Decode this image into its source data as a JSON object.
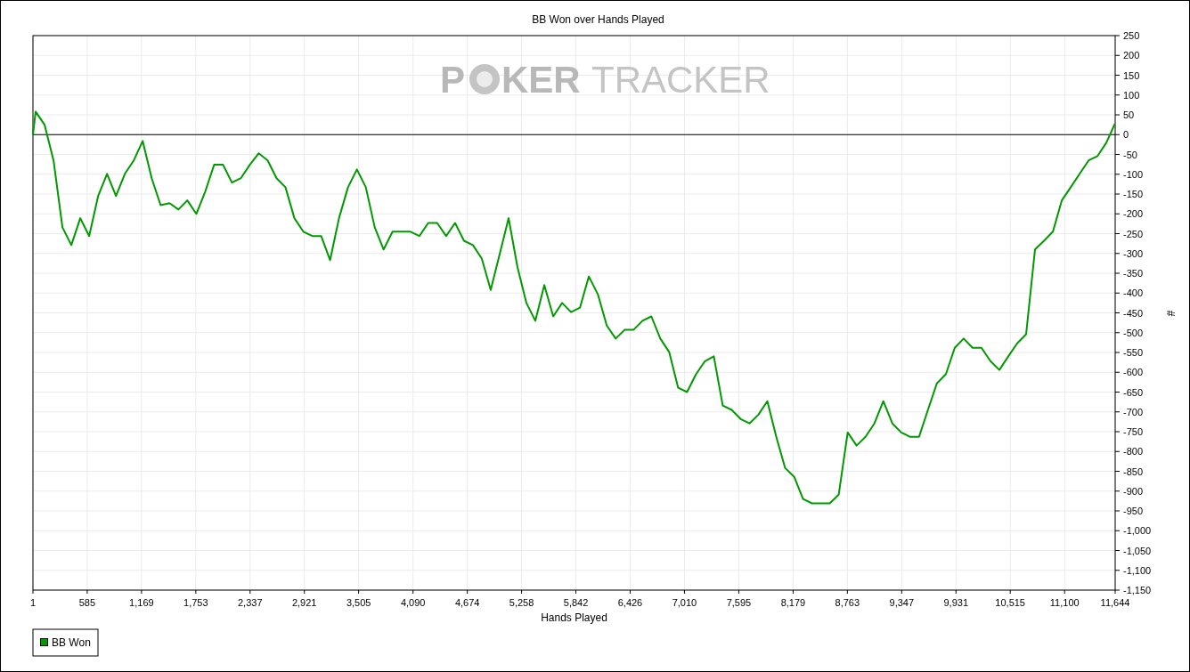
{
  "watermark": {
    "part_1": "P",
    "part_2": "KER",
    "part_3": "TRACKER"
  },
  "chart_data": {
    "type": "line",
    "grid": true,
    "title": "BB Won over Hands Played",
    "xlabel": "Hands Played",
    "ylabel": "#",
    "xlim": [
      1,
      11644
    ],
    "ylim": [
      -1150,
      250
    ],
    "xticks": [
      1,
      585,
      {
        "value": 1169,
        "label": "1,169"
      },
      {
        "value": 1753,
        "label": "1,753"
      },
      {
        "value": 2337,
        "label": "2,337"
      },
      {
        "value": 2921,
        "label": "2,921"
      },
      {
        "value": 3505,
        "label": "3,505"
      },
      {
        "value": 4090,
        "label": "4,090"
      },
      {
        "value": 4674,
        "label": "4,674"
      },
      {
        "value": 5258,
        "label": "5,258"
      },
      {
        "value": 5842,
        "label": "5,842"
      },
      {
        "value": 6426,
        "label": "6,426"
      },
      {
        "value": 7010,
        "label": "7,010"
      },
      {
        "value": 7595,
        "label": "7,595"
      },
      {
        "value": 8179,
        "label": "8,179"
      },
      {
        "value": 8763,
        "label": "8,763"
      },
      {
        "value": 9347,
        "label": "9,347"
      },
      {
        "value": 9931,
        "label": "9,931"
      },
      {
        "value": 10515,
        "label": "10,515"
      },
      {
        "value": 11100,
        "label": "11,100"
      },
      {
        "value": 11644,
        "label": "11,644"
      }
    ],
    "yticks": [
      250,
      200,
      150,
      100,
      50,
      0,
      -50,
      -100,
      -150,
      -200,
      -250,
      -300,
      -350,
      -400,
      -450,
      -500,
      -550,
      -600,
      -650,
      -700,
      -750,
      -800,
      -850,
      -900,
      -950,
      {
        "value": -1000,
        "label": "-1,000"
      },
      {
        "value": -1050,
        "label": "-1,050"
      },
      {
        "value": -1100,
        "label": "-1,100"
      },
      {
        "value": -1150,
        "label": "-1,150"
      }
    ],
    "x": [
      1,
      30,
      126,
      222,
      318,
      414,
      510,
      606,
      702,
      798,
      894,
      990,
      1086,
      1182,
      1278,
      1374,
      1470,
      1566,
      1662,
      1758,
      1854,
      1950,
      2046,
      2142,
      2238,
      2334,
      2430,
      2526,
      2622,
      2718,
      2814,
      2910,
      3006,
      3102,
      3198,
      3294,
      3390,
      3486,
      3582,
      3678,
      3774,
      3870,
      3966,
      4062,
      4158,
      4254,
      4350,
      4446,
      4542,
      4638,
      4734,
      4830,
      4926,
      5022,
      5118,
      5214,
      5310,
      5406,
      5502,
      5598,
      5694,
      5790,
      5886,
      5982,
      6078,
      6174,
      6270,
      6366,
      6462,
      6558,
      6654,
      6750,
      6846,
      6942,
      7038,
      7134,
      7230,
      7326,
      7422,
      7518,
      7614,
      7710,
      7806,
      7902,
      7998,
      8094,
      8190,
      8286,
      8382,
      8478,
      8574,
      8670,
      8766,
      8862,
      8958,
      9054,
      9150,
      9246,
      9342,
      9438,
      9534,
      9630,
      9726,
      9822,
      9918,
      10014,
      10110,
      10206,
      10302,
      10398,
      10494,
      10590,
      10686,
      10782,
      10878,
      10974,
      11070,
      11166,
      11262,
      11358,
      11454,
      11550,
      11640
    ],
    "series": [
      {
        "name": "BB Won",
        "color": "#009900",
        "values": [
          0,
          58,
          25,
          -65,
          -234,
          -279,
          -211,
          -256,
          -155,
          -99,
          -155,
          -99,
          -65,
          -16,
          -110,
          -178,
          -173,
          -189,
          -166,
          -200,
          -144,
          -76,
          -76,
          -121,
          -110,
          -76,
          -47,
          -65,
          -110,
          -133,
          -211,
          -245,
          -256,
          -256,
          -317,
          -211,
          -133,
          -88,
          -133,
          -234,
          -290,
          -245,
          -245,
          -245,
          -256,
          -223,
          -223,
          -256,
          -223,
          -268,
          -279,
          -313,
          -392,
          -302,
          -211,
          -335,
          -425,
          -470,
          -380,
          -459,
          -425,
          -448,
          -437,
          -358,
          -403,
          -482,
          -515,
          -493,
          -493,
          -470,
          -459,
          -515,
          -549,
          -639,
          -650,
          -605,
          -572,
          -560,
          -684,
          -695,
          -718,
          -729,
          -707,
          -673,
          -763,
          -842,
          -864,
          -920,
          -931,
          -931,
          -931,
          -909,
          -752,
          -785,
          -763,
          -729,
          -673,
          -729,
          -752,
          -763,
          -763,
          -695,
          -628,
          -605,
          -538,
          -515,
          -538,
          -538,
          -572,
          -594,
          -560,
          -527,
          -504,
          -290,
          -268,
          -245,
          -166,
          -133,
          -99,
          -65,
          -54,
          -20,
          27
        ]
      }
    ]
  }
}
